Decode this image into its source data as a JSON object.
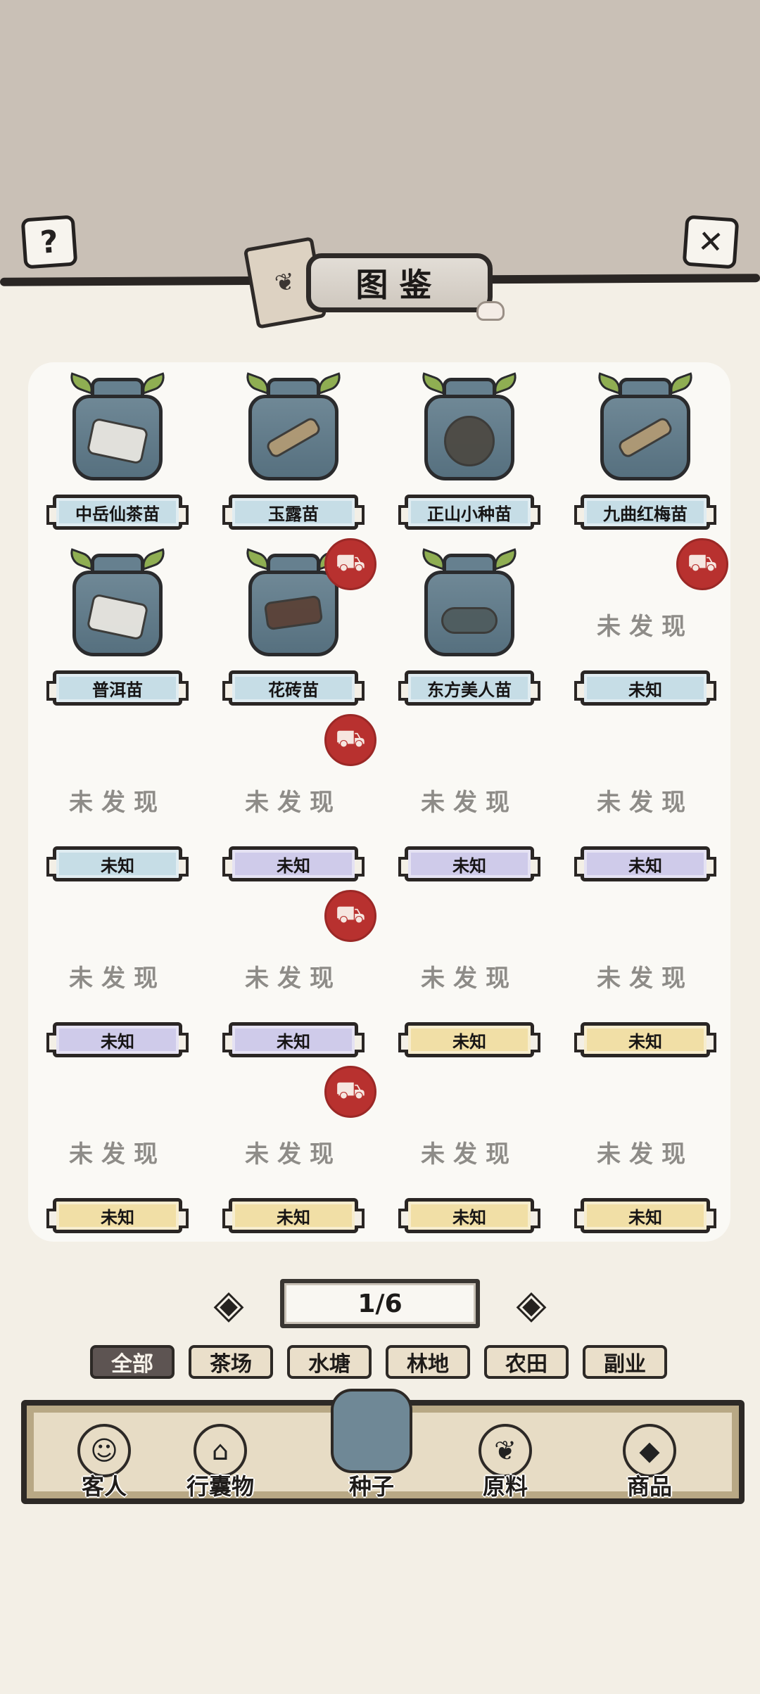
{
  "header": {
    "title": "图鉴",
    "help_icon": "?",
    "close_icon": "✕"
  },
  "grid": {
    "undiscovered_text": "未发现",
    "items": [
      {
        "label": "中岳仙茶苗",
        "tier": "blue",
        "discovered": true,
        "stamp": false,
        "art": "paper"
      },
      {
        "label": "玉露苗",
        "tier": "blue",
        "discovered": true,
        "stamp": false,
        "art": "stick"
      },
      {
        "label": "正山小种苗",
        "tier": "blue",
        "discovered": true,
        "stamp": false,
        "art": "round"
      },
      {
        "label": "九曲红梅苗",
        "tier": "blue",
        "discovered": true,
        "stamp": false,
        "art": "stick"
      },
      {
        "label": "普洱苗",
        "tier": "blue",
        "discovered": true,
        "stamp": false,
        "art": "paper"
      },
      {
        "label": "花砖苗",
        "tier": "blue",
        "discovered": true,
        "stamp": true,
        "art": "brick"
      },
      {
        "label": "东方美人苗",
        "tier": "blue",
        "discovered": true,
        "stamp": false,
        "art": "fish"
      },
      {
        "label": "未知",
        "tier": "blue",
        "discovered": false,
        "stamp": true
      },
      {
        "label": "未知",
        "tier": "blue",
        "discovered": false,
        "stamp": false
      },
      {
        "label": "未知",
        "tier": "purple",
        "discovered": false,
        "stamp": true
      },
      {
        "label": "未知",
        "tier": "purple",
        "discovered": false,
        "stamp": false
      },
      {
        "label": "未知",
        "tier": "purple",
        "discovered": false,
        "stamp": false
      },
      {
        "label": "未知",
        "tier": "purple",
        "discovered": false,
        "stamp": false
      },
      {
        "label": "未知",
        "tier": "purple",
        "discovered": false,
        "stamp": true
      },
      {
        "label": "未知",
        "tier": "gold",
        "discovered": false,
        "stamp": false
      },
      {
        "label": "未知",
        "tier": "gold",
        "discovered": false,
        "stamp": false
      },
      {
        "label": "未知",
        "tier": "gold",
        "discovered": false,
        "stamp": false
      },
      {
        "label": "未知",
        "tier": "gold",
        "discovered": false,
        "stamp": true
      },
      {
        "label": "未知",
        "tier": "gold",
        "discovered": false,
        "stamp": false
      },
      {
        "label": "未知",
        "tier": "gold",
        "discovered": false,
        "stamp": false
      }
    ]
  },
  "pager": {
    "page_text": "1/6",
    "prev_icon": "◈",
    "next_icon": "◈"
  },
  "filters": [
    "全部",
    "茶场",
    "水塘",
    "林地",
    "农田",
    "副业"
  ],
  "active_filter": 0,
  "bottom_nav": [
    {
      "label": "客人",
      "icon": "guest-icon",
      "glyph": "☺"
    },
    {
      "label": "行囊物",
      "icon": "clothes-icon",
      "glyph": "⌂"
    },
    {
      "label": "种子",
      "icon": "seed-bag-icon",
      "glyph": "",
      "selected": true
    },
    {
      "label": "原料",
      "icon": "leaf-icon",
      "glyph": "❦"
    },
    {
      "label": "商品",
      "icon": "goods-icon",
      "glyph": "◆"
    }
  ],
  "colors": {
    "stamp_red": "#b8312f",
    "tier_blue": "#c6dde6",
    "tier_purple": "#cfcbea",
    "tier_gold": "#f1dfa6"
  }
}
